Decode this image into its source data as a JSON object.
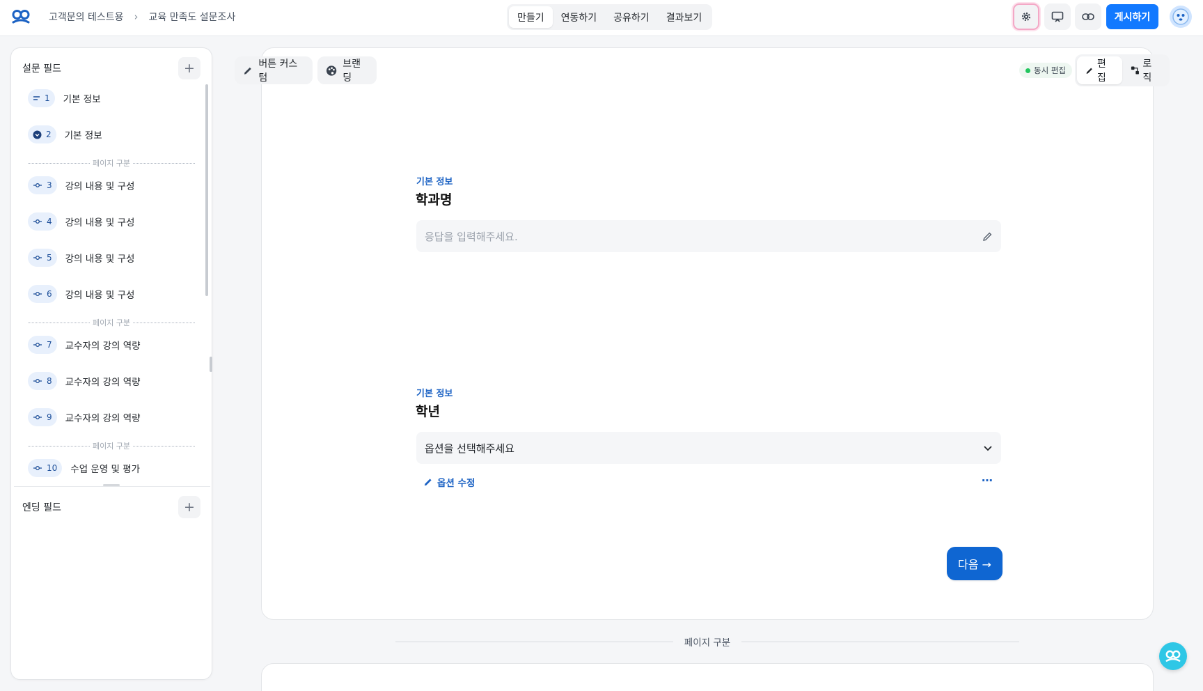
{
  "header": {
    "breadcrumbs": [
      "고객문의 테스트용",
      "교육 만족도 설문조사"
    ],
    "tabs": [
      "만들기",
      "연동하기",
      "공유하기",
      "결과보기"
    ],
    "active_tab": "만들기",
    "publish_label": "게시하기",
    "icons": [
      "logo-icon",
      "settings-icon",
      "present-icon",
      "link-icon",
      "avatar"
    ]
  },
  "sidebar": {
    "survey_fields_title": "설문 필드",
    "ending_fields_title": "엔딩 필드",
    "page_divider_label": "페이지 구분",
    "items": [
      {
        "num": "1",
        "label": "기본 정보",
        "icon": "equals-icon"
      },
      {
        "num": "2",
        "label": "기본 정보",
        "icon": "chevron-circle-icon"
      },
      {
        "num": "3",
        "label": "강의 내용 및 구성",
        "icon": "scale-icon"
      },
      {
        "num": "4",
        "label": "강의 내용 및 구성",
        "icon": "scale-icon"
      },
      {
        "num": "5",
        "label": "강의 내용 및 구성",
        "icon": "scale-icon"
      },
      {
        "num": "6",
        "label": "강의 내용 및 구성",
        "icon": "scale-icon"
      },
      {
        "num": "7",
        "label": "교수자의 강의 역량",
        "icon": "scale-icon"
      },
      {
        "num": "8",
        "label": "교수자의 강의 역량",
        "icon": "scale-icon"
      },
      {
        "num": "9",
        "label": "교수자의 강의 역량",
        "icon": "scale-icon"
      },
      {
        "num": "10",
        "label": "수업 운영 및 평가",
        "icon": "scale-icon"
      }
    ]
  },
  "toolbar": {
    "button_custom_label": "버튼 커스텀",
    "branding_label": "브랜딩",
    "live_edit_label": "동시 편집",
    "edit_label": "편집",
    "logic_label": "로직"
  },
  "questions": [
    {
      "category": "기본 정보",
      "title": "학과명",
      "placeholder": "응답을 입력해주세요."
    },
    {
      "category": "기본 정보",
      "title": "학년",
      "select_placeholder": "옵션을 선택해주세요",
      "option_edit_label": "옵션 수정"
    }
  ],
  "next_button_label": "다음 →",
  "page_break_label": "페이지 구분",
  "colors": {
    "accent": "#1279ff",
    "primary_button": "#0f66d2",
    "category_text": "#1d63c4",
    "live_dot": "#22c55e"
  }
}
